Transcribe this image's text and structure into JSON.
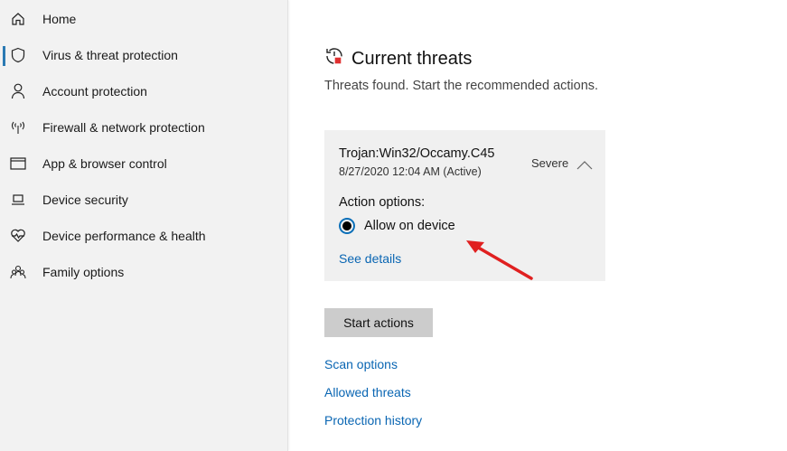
{
  "sidebar": {
    "items": [
      {
        "label": "Home",
        "icon": "home-icon"
      },
      {
        "label": "Virus & threat protection",
        "icon": "shield-icon",
        "active": true
      },
      {
        "label": "Account protection",
        "icon": "person-icon"
      },
      {
        "label": "Firewall & network protection",
        "icon": "antenna-icon"
      },
      {
        "label": "App & browser control",
        "icon": "window-icon"
      },
      {
        "label": "Device security",
        "icon": "laptop-icon"
      },
      {
        "label": "Device performance & health",
        "icon": "heart-icon"
      },
      {
        "label": "Family options",
        "icon": "family-icon"
      }
    ]
  },
  "main": {
    "title": "Current threats",
    "subtitle": "Threats found. Start the recommended actions.",
    "threat": {
      "name": "Trojan:Win32/Occamy.C45",
      "date": "8/27/2020 12:04 AM (Active)",
      "severity": "Severe",
      "action_label": "Action options:",
      "option": "Allow on device",
      "see_details": "See details"
    },
    "start_button": "Start actions",
    "links": [
      "Scan options",
      "Allowed threats",
      "Protection history"
    ]
  },
  "colors": {
    "accent": "#0a66b3",
    "arrow": "#e02020"
  }
}
